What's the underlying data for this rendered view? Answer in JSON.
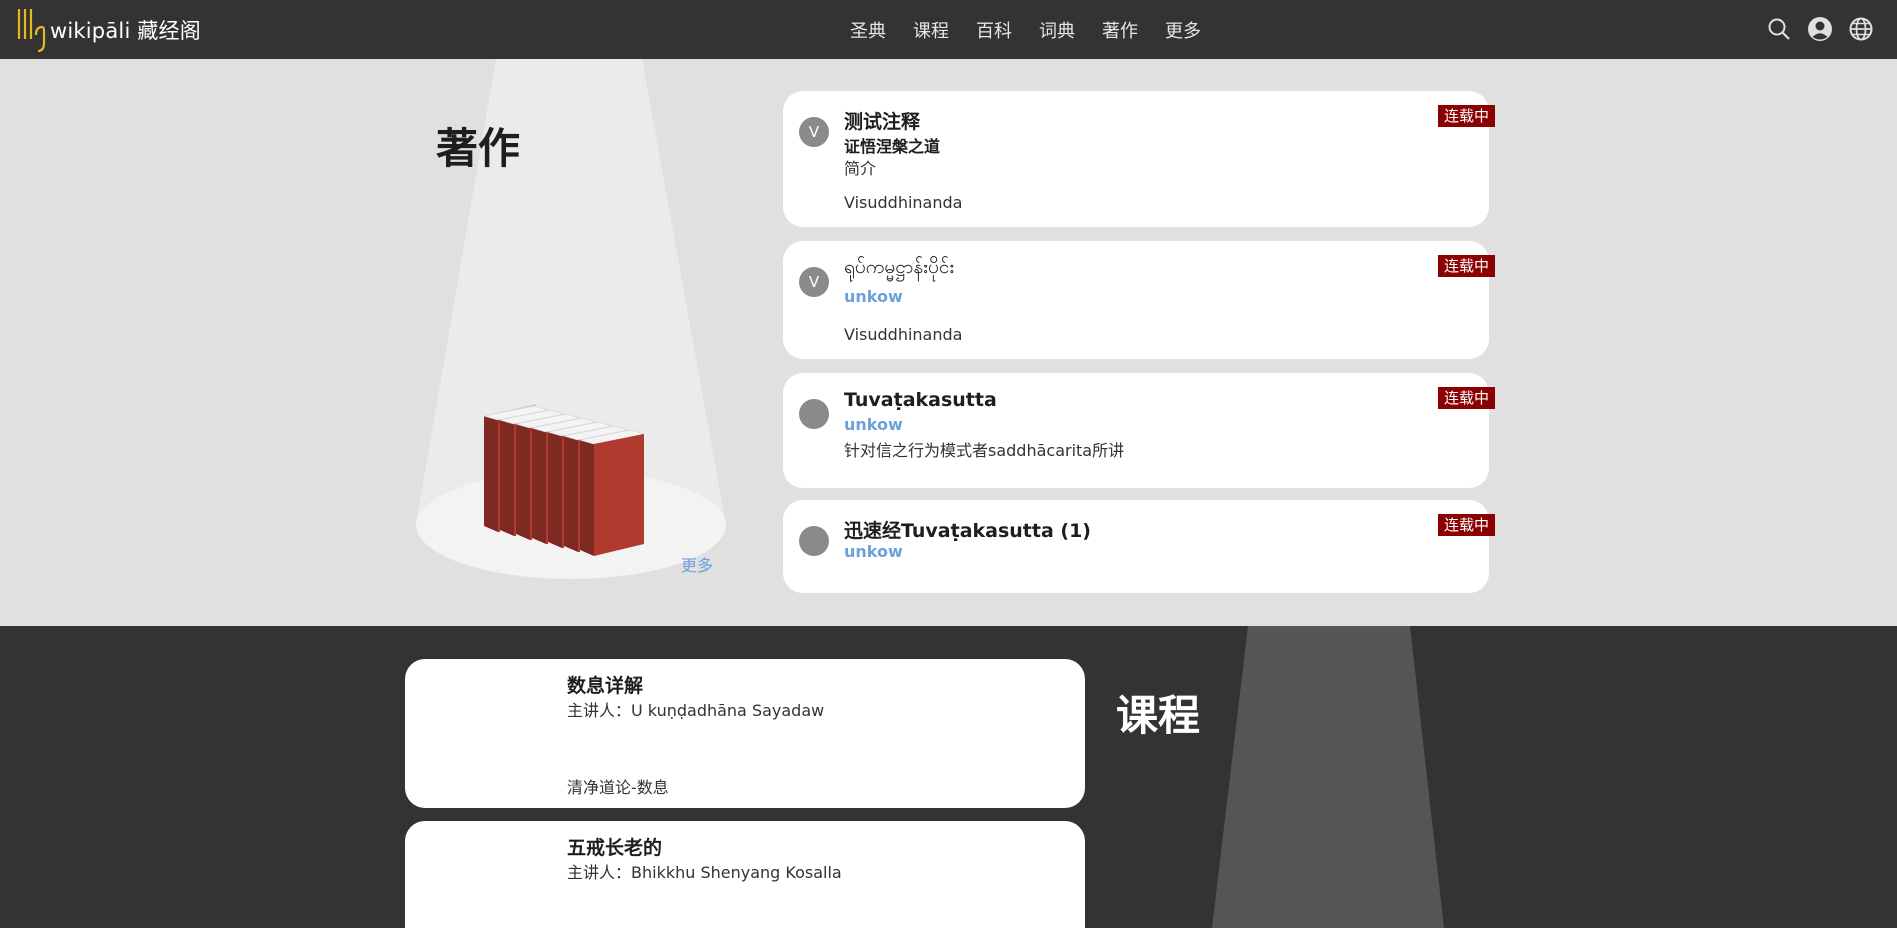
{
  "header": {
    "logo_text": "wikipāli 藏经阁",
    "nav": [
      "圣典",
      "课程",
      "百科",
      "词典",
      "著作",
      "更多"
    ],
    "icons": [
      "search-icon",
      "user-icon",
      "globe-icon"
    ]
  },
  "works": {
    "title": "著作",
    "more_label": "更多",
    "cards": [
      {
        "avatar": "V",
        "title": "测试注释",
        "subtitle": "证悟涅槃之道",
        "lines": [
          "简介",
          "Visuddhinanda"
        ],
        "badge": "连载中"
      },
      {
        "avatar": "V",
        "title": "ရုပ်ကမ္မဋ္ဌာန်းပိုင်း",
        "subtitle": "unkow",
        "lines": [
          "Visuddhinanda"
        ],
        "badge": "连载中"
      },
      {
        "avatar": "",
        "title": "Tuvaṭakasutta",
        "subtitle": "unkow",
        "lines": [
          "针对信之行为模式者saddhācarita所讲"
        ],
        "badge": "连载中"
      },
      {
        "avatar": "",
        "title": "迅速经Tuvaṭakasutta (1)",
        "subtitle": "unkow",
        "lines": [],
        "badge": "连载中"
      }
    ]
  },
  "courses": {
    "title": "课程",
    "cards": [
      {
        "title": "数息详解",
        "teacher": "主讲人：U kuṇḍadhāna Sayadaw",
        "desc": "清净道论-数息"
      },
      {
        "title": "五戒长老的",
        "teacher": "主讲人：Bhikkhu Shenyang Kosalla",
        "desc": ""
      }
    ]
  },
  "colors": {
    "header_bg": "#333333",
    "badge_bg": "#8b0000",
    "link": "#6ea1db",
    "book_red": "#b03a2e",
    "logo_gold": "#e8b820"
  }
}
